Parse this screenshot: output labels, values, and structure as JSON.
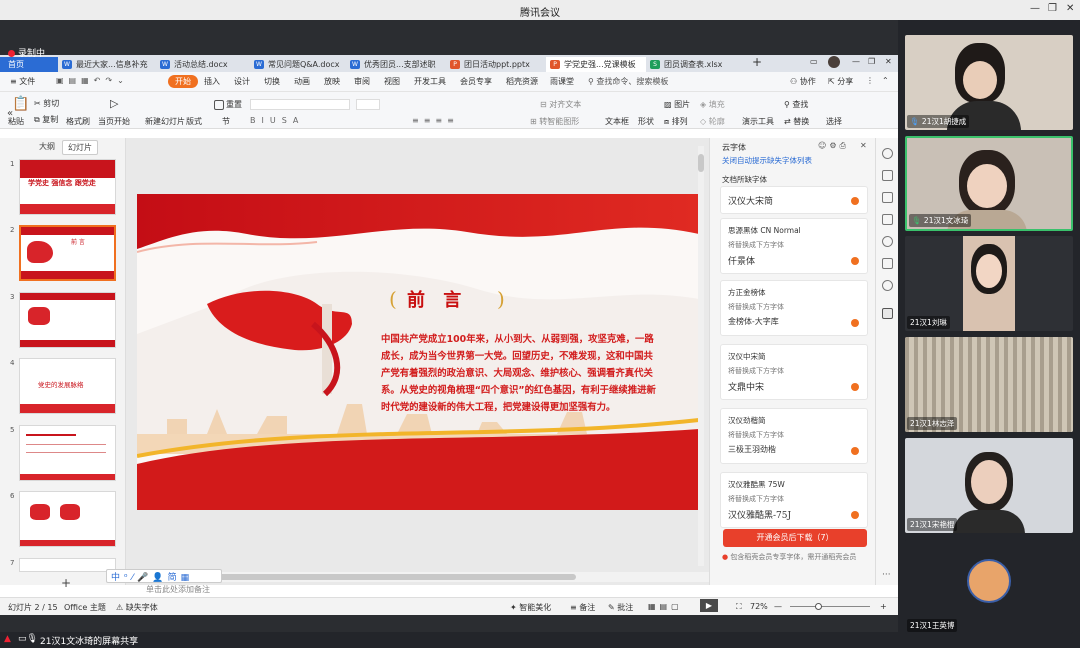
{
  "window": {
    "title": "腾讯会议"
  },
  "recording": {
    "label": "录制中"
  },
  "doc_tabs": [
    {
      "label": "最近大家...信息补充",
      "icon": "W",
      "color": "#2b6cd4"
    },
    {
      "label": "活动总结.docx",
      "icon": "W",
      "color": "#2b6cd4"
    },
    {
      "label": "常见问题Q&A.docx",
      "icon": "W",
      "color": "#2b6cd4"
    },
    {
      "label": "优秀团员...支部述职",
      "icon": "W",
      "color": "#2b6cd4"
    },
    {
      "label": "团日活动ppt.pptx",
      "icon": "P",
      "color": "#e0552b"
    },
    {
      "label": "学党史强...党课模板",
      "icon": "P",
      "color": "#e0552b"
    },
    {
      "label": "团员调查表.xlsx",
      "icon": "S",
      "color": "#1e9e5a"
    }
  ],
  "menu": {
    "file": "文件",
    "items": [
      "开始",
      "插入",
      "设计",
      "切换",
      "动画",
      "放映",
      "审阅",
      "视图",
      "开发工具",
      "会员专享",
      "稻壳资源",
      "雨课堂"
    ],
    "search": "查找命令、搜索模板",
    "collab": "协作",
    "share": "分享"
  },
  "ribbon": {
    "paste": "粘贴",
    "cut": "剪切",
    "copy": "复制",
    "format_painter": "格式刷",
    "from_current": "当页开始",
    "new_slide": "新建幻灯片",
    "layout": "版式",
    "section": "节",
    "reset": "重置",
    "align_text": "对齐文本",
    "smart_art": "转智能图形",
    "textbox": "文本框",
    "shape": "形状",
    "picture": "图片",
    "fill": "填充",
    "arrange": "排列",
    "outline": "轮廓",
    "slideshow": "演示工具",
    "find": "查找",
    "replace": "替换",
    "select": "选择"
  },
  "left_pane": {
    "tab_outline": "大纲",
    "tab_slides": "幻灯片",
    "slide_numbers": [
      "1",
      "2",
      "3",
      "4",
      "5",
      "6",
      "7"
    ]
  },
  "slide": {
    "title": "前 言",
    "body": "中国共产党成立100年来，从小到大、从弱到强，攻坚克难，一路成长，成为当今世界第一大党。回望历史，不难发现，这和中国共产党有着强烈的政治意识、大局观念、维护核心、强调看齐真代关系。从党史的视角梳理“四个意识”的红色基因，有利于继续推进新时代党的建设新的伟大工程，把党建设得更加坚强有力。",
    "thumb1_title": "学党史 强信念 跟党走",
    "thumb4_title": "党史的发展脉络",
    "thumb2_title": "前 言"
  },
  "font_panel": {
    "title": "云字体",
    "close_hint": "关闭自动提示缺失字体列表",
    "missing_header": "文档所缺字体",
    "replace_hint": "将替换成下方字体",
    "fonts": [
      {
        "name": "汉仪大宋简",
        "preview": ""
      },
      {
        "name": "思源黑体 CN Normal",
        "preview": "仟景体"
      },
      {
        "name": "方正金榜体",
        "preview": "金榜体-大字库"
      },
      {
        "name": "汉仪中宋简",
        "preview": "文鼎中宋"
      },
      {
        "name": "汉仪劲楷简",
        "preview": "三极王羽劲楷"
      },
      {
        "name": "汉仪雅酷黑 75W",
        "preview": "汉仪雅酷黑-75J"
      }
    ],
    "download_button": "开通会员后下载（7）",
    "footer": "包含稻壳会员专享字体，需开通稻壳会员"
  },
  "status": {
    "slide_info": "幻灯片 2 / 15",
    "theme": "Office 主题",
    "missing_fonts": "缺失字体",
    "beautify": "智能美化",
    "notes": "备注",
    "comments": "批注",
    "zoom": "72%",
    "notes_placeholder": "单击此处添加备注"
  },
  "participants": [
    {
      "name": "21汉1胡捷成",
      "bg": "#d8cfc4"
    },
    {
      "name": "21汉1文冰琦",
      "bg": "#c9c0b6"
    },
    {
      "name": "21汉1刘琳",
      "bg": "#2e3035"
    },
    {
      "name": "21汉1林志泽",
      "bg": "#b9b0a2"
    },
    {
      "name": "21汉1宋艳棍",
      "bg": "#d4d7dc"
    },
    {
      "name": "21汉1王英博",
      "bg": "#23252a"
    }
  ],
  "bottom": {
    "share_label": "21汉1文冰琦的屏幕共享"
  }
}
